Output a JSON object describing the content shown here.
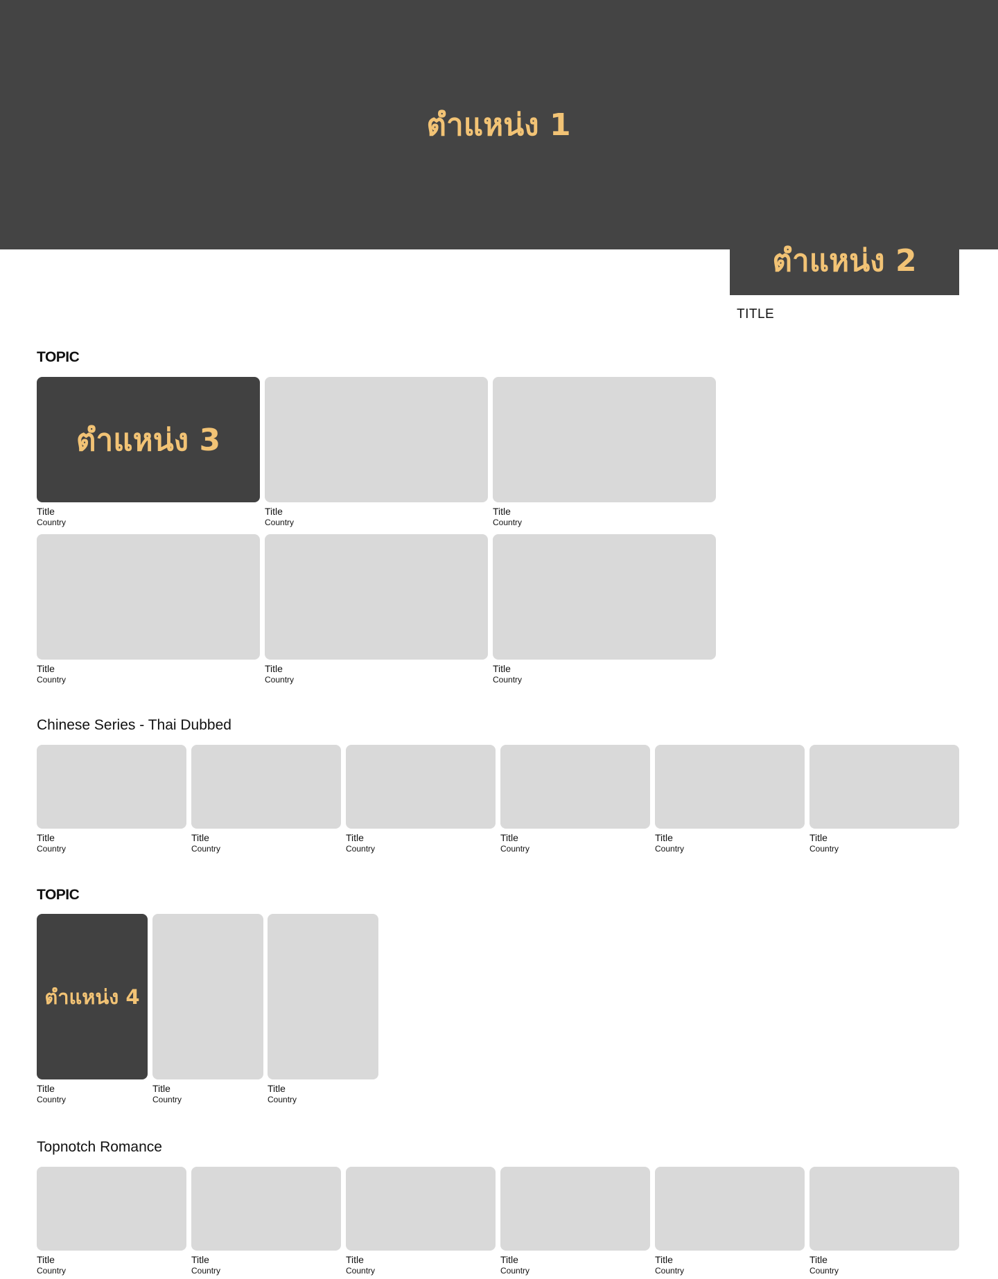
{
  "ads": {
    "slot1": "ตำแหน่ง 1",
    "slot2": "ตำแหน่ง 2",
    "slot3": "ตำแหน่ง 3",
    "slot4": "ตำแหน่ง 4",
    "side_title": "TITLE"
  },
  "colors": {
    "ad_bg": "#444444",
    "ad_text": "#f2c375",
    "placeholder": "#d9d9d9"
  },
  "sections": [
    {
      "title": "TOPIC",
      "cards": [
        {
          "title": "Title",
          "country": "Country"
        },
        {
          "title": "Title",
          "country": "Country"
        },
        {
          "title": "Title",
          "country": "Country"
        },
        {
          "title": "Title",
          "country": "Country"
        },
        {
          "title": "Title",
          "country": "Country"
        },
        {
          "title": "Title",
          "country": "Country"
        }
      ]
    },
    {
      "title": "Chinese Series - Thai Dubbed",
      "cards": [
        {
          "title": "Title",
          "country": "Country"
        },
        {
          "title": "Title",
          "country": "Country"
        },
        {
          "title": "Title",
          "country": "Country"
        },
        {
          "title": "Title",
          "country": "Country"
        },
        {
          "title": "Title",
          "country": "Country"
        },
        {
          "title": "Title",
          "country": "Country"
        }
      ]
    },
    {
      "title": "TOPIC",
      "cards": [
        {
          "title": "Title",
          "country": "Country"
        },
        {
          "title": "Title",
          "country": "Country"
        },
        {
          "title": "Title",
          "country": "Country"
        }
      ]
    },
    {
      "title": "Topnotch Romance",
      "cards": [
        {
          "title": "Title",
          "country": "Country"
        },
        {
          "title": "Title",
          "country": "Country"
        },
        {
          "title": "Title",
          "country": "Country"
        },
        {
          "title": "Title",
          "country": "Country"
        },
        {
          "title": "Title",
          "country": "Country"
        },
        {
          "title": "Title",
          "country": "Country"
        }
      ]
    }
  ]
}
